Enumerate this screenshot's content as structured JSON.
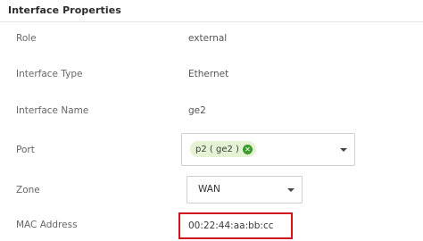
{
  "section": {
    "title": "Interface Properties"
  },
  "fields": {
    "role": {
      "label": "Role",
      "value": "external"
    },
    "interface_type": {
      "label": "Interface Type",
      "value": "Ethernet"
    },
    "interface_name": {
      "label": "Interface Name",
      "value": "ge2"
    },
    "port": {
      "label": "Port",
      "chip": "p2 ( ge2 )",
      "chip_remove_icon": "close-circle-icon",
      "dropdown_icon": "chevron-down-icon"
    },
    "zone": {
      "label": "Zone",
      "selected": "WAN",
      "dropdown_icon": "chevron-down-icon"
    },
    "mac_address": {
      "label": "MAC Address",
      "value": "00:22:44:aa:bb:cc"
    }
  },
  "colors": {
    "chip_background": "#e6f2d4",
    "chip_close": "#3c9a2f",
    "highlight_border": "#d0101b"
  }
}
